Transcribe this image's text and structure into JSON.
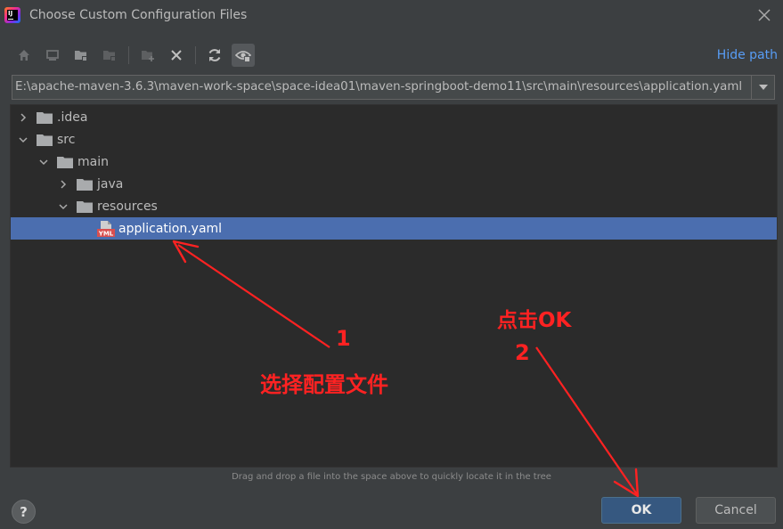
{
  "window": {
    "title": "Choose Custom Configuration Files"
  },
  "toolbar": {
    "buttons": [
      "home-icon",
      "desktop-icon",
      "project-folder-icon",
      "module-folder-icon",
      "new-folder-icon",
      "delete-icon",
      "refresh-icon",
      "show-hidden-icon"
    ],
    "hide_path_label": "Hide path"
  },
  "path": {
    "value": "E:\\apache-maven-3.6.3\\maven-work-space\\space-idea01\\maven-springboot-demo11\\src\\main\\resources\\application.yaml"
  },
  "tree": {
    "items": [
      {
        "label": ".idea",
        "type": "folder",
        "expanded": false,
        "depth": 0
      },
      {
        "label": "src",
        "type": "folder",
        "expanded": true,
        "depth": 0
      },
      {
        "label": "main",
        "type": "folder",
        "expanded": true,
        "depth": 1
      },
      {
        "label": "java",
        "type": "folder",
        "expanded": false,
        "depth": 2
      },
      {
        "label": "resources",
        "type": "folder",
        "expanded": true,
        "depth": 2
      },
      {
        "label": "application.yaml",
        "type": "yaml-file",
        "selected": true,
        "depth": 3
      }
    ]
  },
  "hint": "Drag and drop a file into the space above to quickly locate it in the tree",
  "buttons": {
    "help": "?",
    "ok": "OK",
    "cancel": "Cancel"
  },
  "annotations": {
    "step1_number": "1",
    "step1_text": "选择配置文件",
    "step2_title": "点击OK",
    "step2_number": "2",
    "color": "#ff2222"
  },
  "colors": {
    "background": "#3c3f41",
    "tree_background": "#2b2b2b",
    "selection": "#4b6eaf",
    "link": "#589df6",
    "ok_button": "#365880"
  }
}
